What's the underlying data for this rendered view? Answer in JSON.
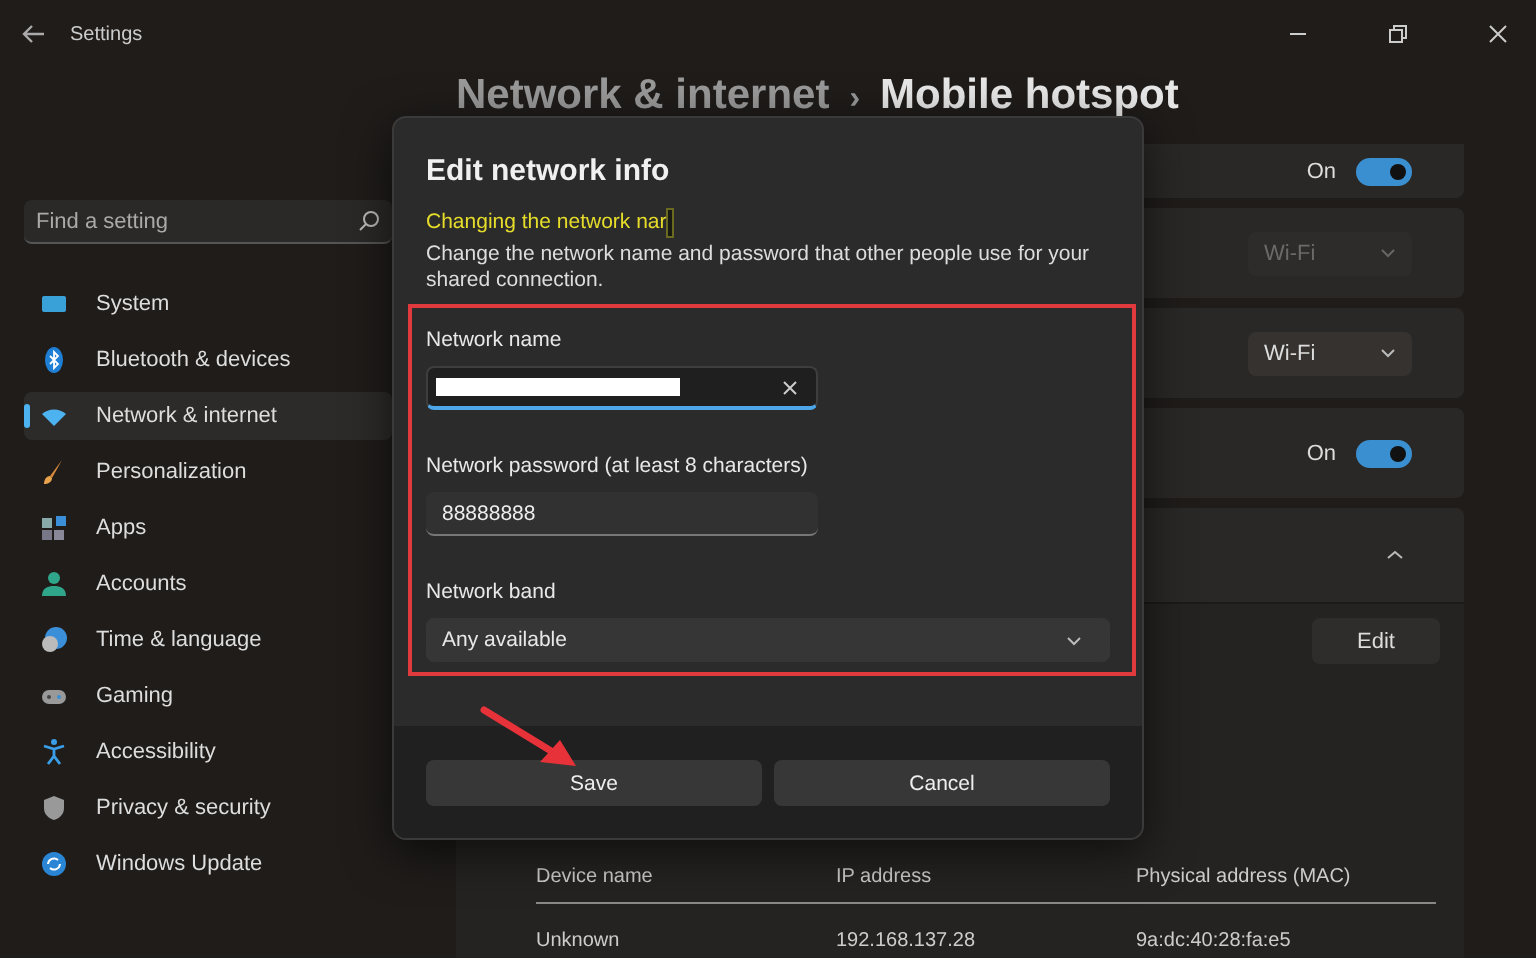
{
  "window": {
    "title": "Settings"
  },
  "sidebar": {
    "search": {
      "placeholder": "Find a setting"
    },
    "items": [
      {
        "label": "System",
        "selected": false
      },
      {
        "label": "Bluetooth & devices",
        "selected": false
      },
      {
        "label": "Network & internet",
        "selected": true
      },
      {
        "label": "Personalization",
        "selected": false
      },
      {
        "label": "Apps",
        "selected": false
      },
      {
        "label": "Accounts",
        "selected": false
      },
      {
        "label": "Time & language",
        "selected": false
      },
      {
        "label": "Gaming",
        "selected": false
      },
      {
        "label": "Accessibility",
        "selected": false
      },
      {
        "label": "Privacy & security",
        "selected": false
      },
      {
        "label": "Windows Update",
        "selected": false
      }
    ]
  },
  "breadcrumb": {
    "parent": "Network & internet",
    "separator": "›",
    "current": "Mobile hotspot"
  },
  "cards": [
    {
      "kind": "toggle",
      "on": true,
      "label": "On"
    },
    {
      "kind": "dropdown",
      "value": "Wi-Fi",
      "disabled": true
    },
    {
      "kind": "dropdown",
      "value": "Wi-Fi",
      "disabled": false
    },
    {
      "kind": "toggle",
      "on": true,
      "label": "On"
    },
    {
      "kind": "expander",
      "expanded": true,
      "button": "Edit",
      "table": {
        "columns": [
          "Device name",
          "IP address",
          "Physical address (MAC)"
        ],
        "rows": [
          [
            "Unknown",
            "192.168.137.28",
            "9a:dc:40:28:fa:e5"
          ]
        ]
      }
    }
  ],
  "dialog": {
    "title": "Edit network info",
    "highlight_note": "Changing the network nar",
    "description": "Change the network name and password that other people use for your shared connection.",
    "fields": [
      {
        "kind": "text",
        "label": "Network name",
        "value_hidden": true,
        "focused": true
      },
      {
        "kind": "text",
        "label": "Network password (at least 8 characters)",
        "value": "88888888",
        "focused": false
      },
      {
        "kind": "select",
        "label": "Network band",
        "value": "Any available"
      }
    ],
    "buttons": [
      "Save",
      "Cancel"
    ]
  }
}
